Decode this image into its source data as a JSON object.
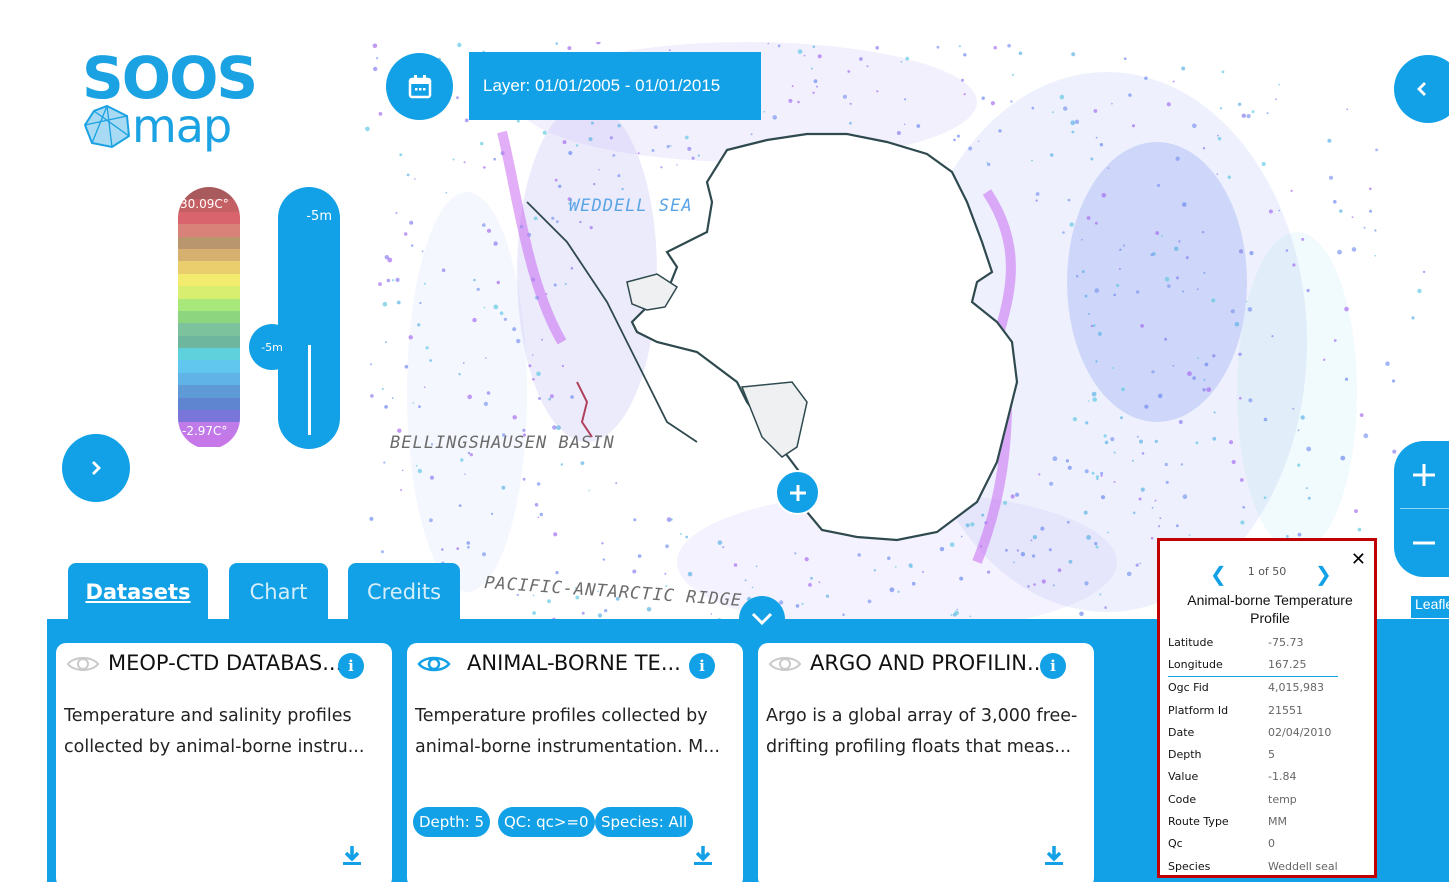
{
  "logo": {
    "top": "SOOS",
    "bottom": "map"
  },
  "layer": {
    "label": "Layer: 01/01/2005 - 01/01/2015"
  },
  "legend": {
    "max": "30.09C°",
    "min": "-2.97C°",
    "colors": [
      "#a85a5c",
      "#c45f64",
      "#d9646e",
      "#d9827a",
      "#b9966e",
      "#d5b06e",
      "#eacd6d",
      "#f2eb6d",
      "#d8ee71",
      "#a8e87a",
      "#8dd67f",
      "#7cc39d",
      "#6fb69f",
      "#5ed1dd",
      "#62c7ef",
      "#5fb3e6",
      "#5d9ad6",
      "#6085d0",
      "#7a75d8",
      "#c07be9",
      "#c778e8"
    ]
  },
  "depth": {
    "top": "-5m",
    "handle": "-5m"
  },
  "map_labels": {
    "weddell": "WEDDELL SEA",
    "bellingshausen": "BELLINGSHAUSEN BASIN",
    "pacific": "PACIFIC-ANTARCTIC RIDGE"
  },
  "tabs": [
    "Datasets",
    "Chart",
    "Credits"
  ],
  "cards": [
    {
      "title": "MEOP-CTD DATABAS...",
      "description": "Temperature and salinity profiles collected by animal-borne instru...",
      "visible": false
    },
    {
      "title": "ANIMAL-BORNE TE...",
      "description": "Temperature profiles collected by animal-borne instrumentation. M...",
      "visible": true
    },
    {
      "title": "ARGO AND PROFILIN...",
      "description": "Argo is a global array of 3,000 free-drifting profiling floats that meas...",
      "visible": false
    }
  ],
  "chips": [
    "Depth: 5",
    "QC: qc>=0",
    "Species: All"
  ],
  "popup": {
    "pager": "1 of 50",
    "title": "Animal-borne Temperature Profile",
    "rows": [
      {
        "key": "Latitude",
        "value": "-75.73"
      },
      {
        "key": "Longitude",
        "value": "167.25"
      },
      {
        "key": "Ogc Fid",
        "value": "4,015,983"
      },
      {
        "key": "Platform Id",
        "value": "21551"
      },
      {
        "key": "Date",
        "value": "02/04/2010"
      },
      {
        "key": "Depth",
        "value": "5"
      },
      {
        "key": "Value",
        "value": "-1.84"
      },
      {
        "key": "Code",
        "value": "temp"
      },
      {
        "key": "Route Type",
        "value": "MM"
      },
      {
        "key": "Qc",
        "value": "0"
      },
      {
        "key": "Species",
        "value": "Weddell seal"
      }
    ]
  },
  "attribution": "Leaflet",
  "colors": {
    "accent": "#12a1e6",
    "popup_border": "#c00000"
  }
}
